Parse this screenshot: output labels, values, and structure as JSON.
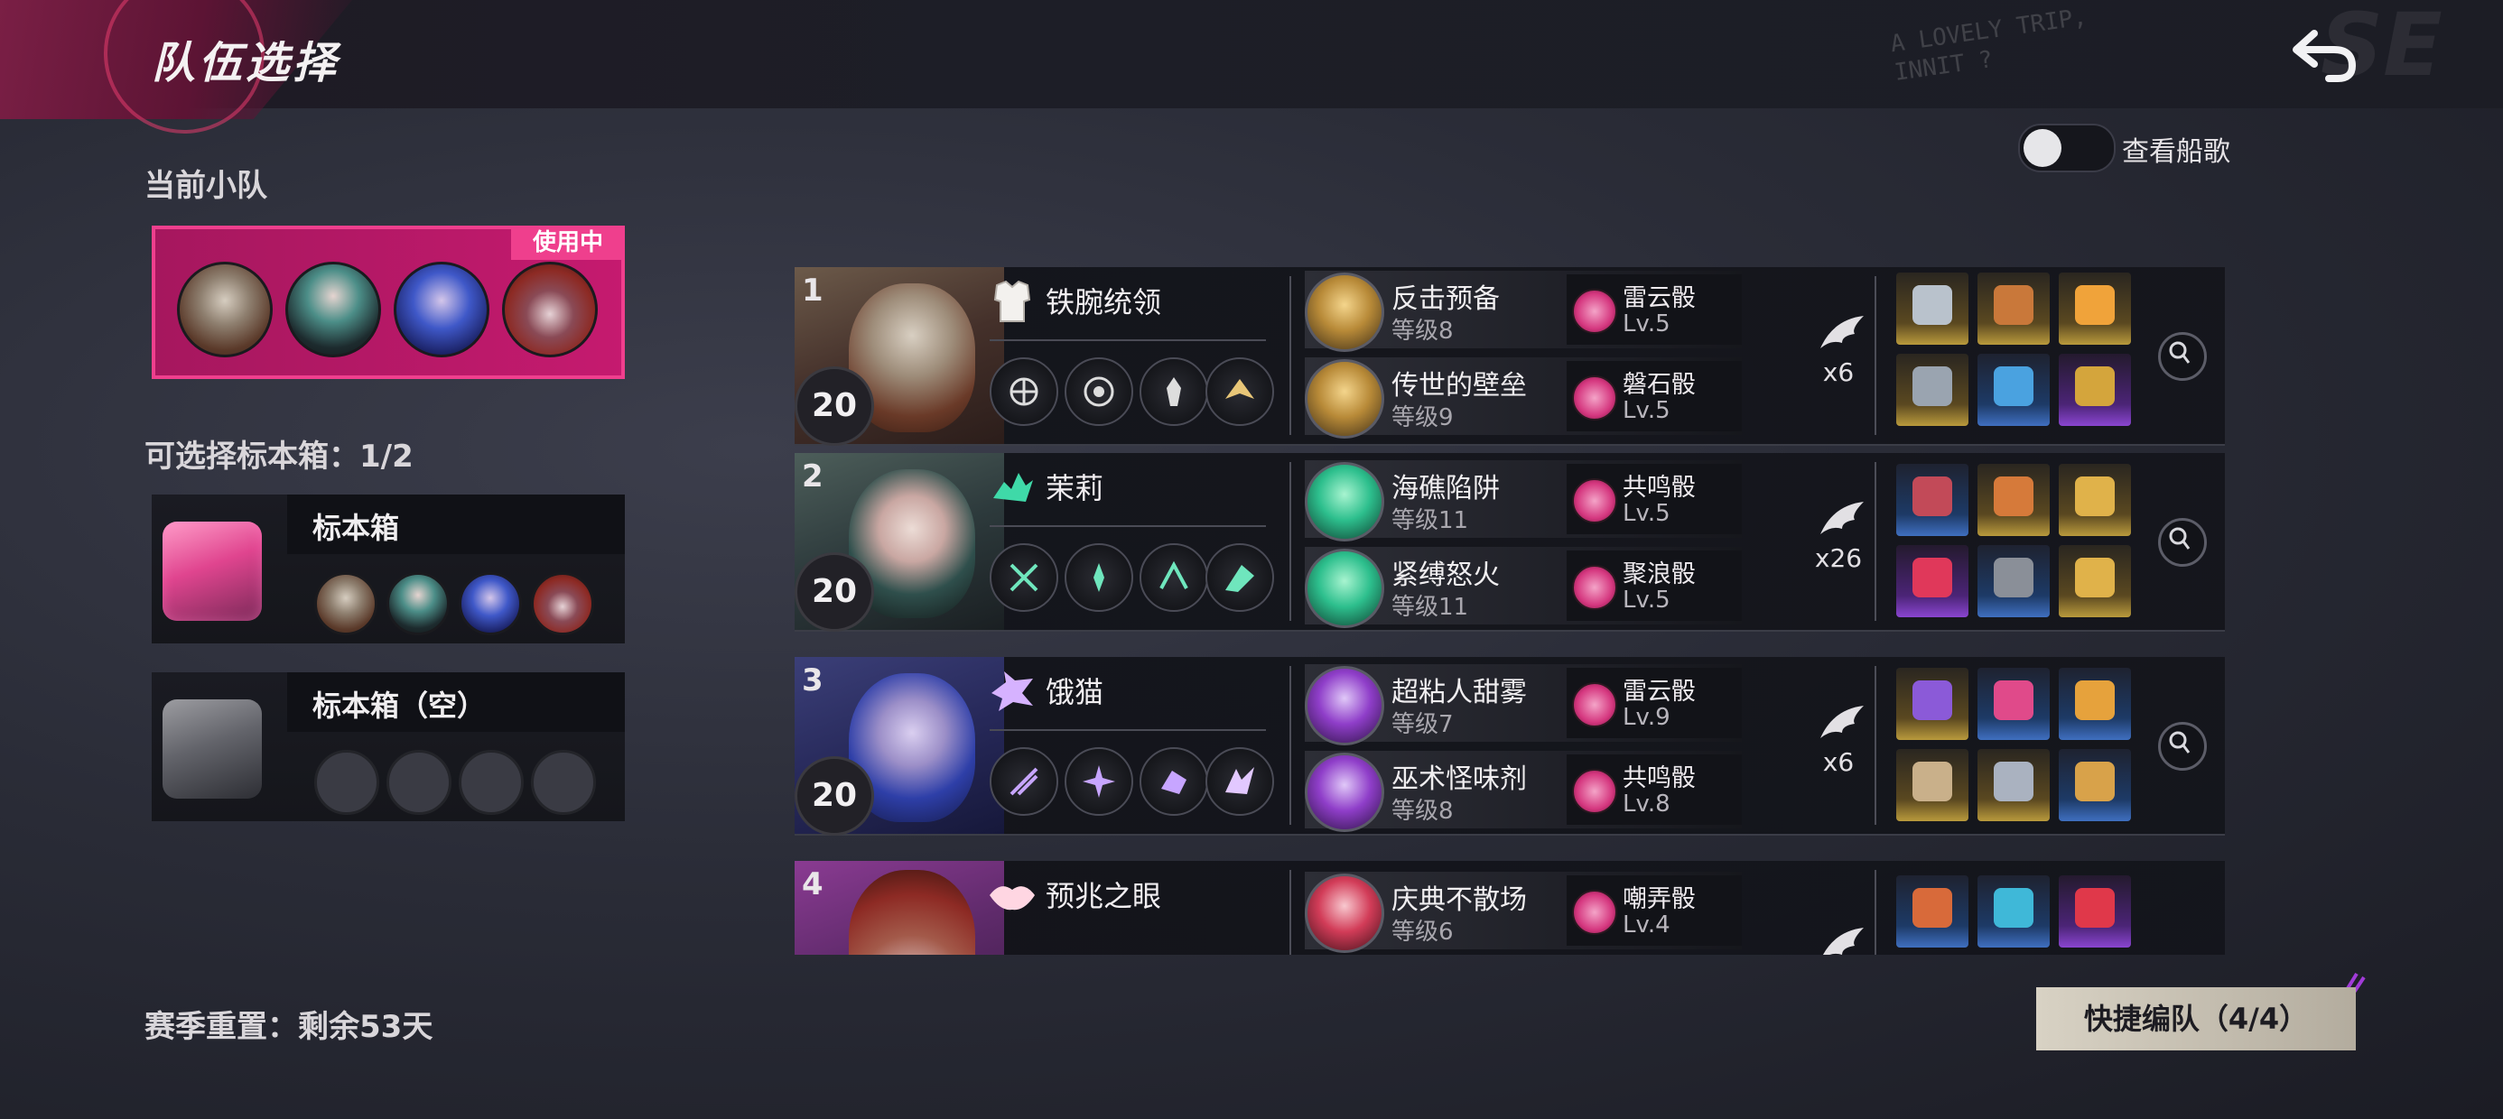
{
  "header": {
    "title": "队伍选择",
    "bg_scribble_text": "A LOVELY TRIP,\nINNIT ?",
    "bg_big_text": "SE"
  },
  "toggle": {
    "label": "查看船歌",
    "on": false
  },
  "current_squad": {
    "label": "当前小队",
    "badge": "使用中"
  },
  "boxes": {
    "label": "可选择标本箱：1/2",
    "items": [
      {
        "title": "标本箱"
      },
      {
        "title": "标本箱（空）"
      }
    ]
  },
  "season": {
    "reset_text": "赛季重置：剩余53天"
  },
  "heroes": [
    {
      "index": "1",
      "level": "20",
      "name": "铁腕统领",
      "count": "x6",
      "abilities": [
        {
          "name": "反击预备",
          "sub": "等级8",
          "die": "雷云骰",
          "die_level": "Lv.5"
        },
        {
          "name": "传世的壁垒",
          "sub": "等级9",
          "die": "磐石骰",
          "die_level": "Lv.5"
        }
      ]
    },
    {
      "index": "2",
      "level": "20",
      "name": "茉莉",
      "count": "x26",
      "abilities": [
        {
          "name": "海礁陷阱",
          "sub": "等级11",
          "die": "共鸣骰",
          "die_level": "Lv.5"
        },
        {
          "name": "紧缚怒火",
          "sub": "等级11",
          "die": "聚浪骰",
          "die_level": "Lv.5"
        }
      ]
    },
    {
      "index": "3",
      "level": "20",
      "name": "饿猫",
      "count": "x6",
      "abilities": [
        {
          "name": "超粘人甜雾",
          "sub": "等级7",
          "die": "雷云骰",
          "die_level": "Lv.9"
        },
        {
          "name": "巫术怪味剂",
          "sub": "等级8",
          "die": "共鸣骰",
          "die_level": "Lv.8"
        }
      ]
    },
    {
      "index": "4",
      "name": "预兆之眼",
      "abilities": [
        {
          "name": "庆典不散场",
          "sub": "等级6",
          "die": "嘲弄骰",
          "die_level": "Lv.4"
        }
      ]
    }
  ],
  "quick_team": {
    "label": "快捷编队（4/4）"
  },
  "colors": {
    "accent_pink": "#e63d8a",
    "badge_pink": "#ef3f8d",
    "button_beige": "#d8d2c4"
  }
}
